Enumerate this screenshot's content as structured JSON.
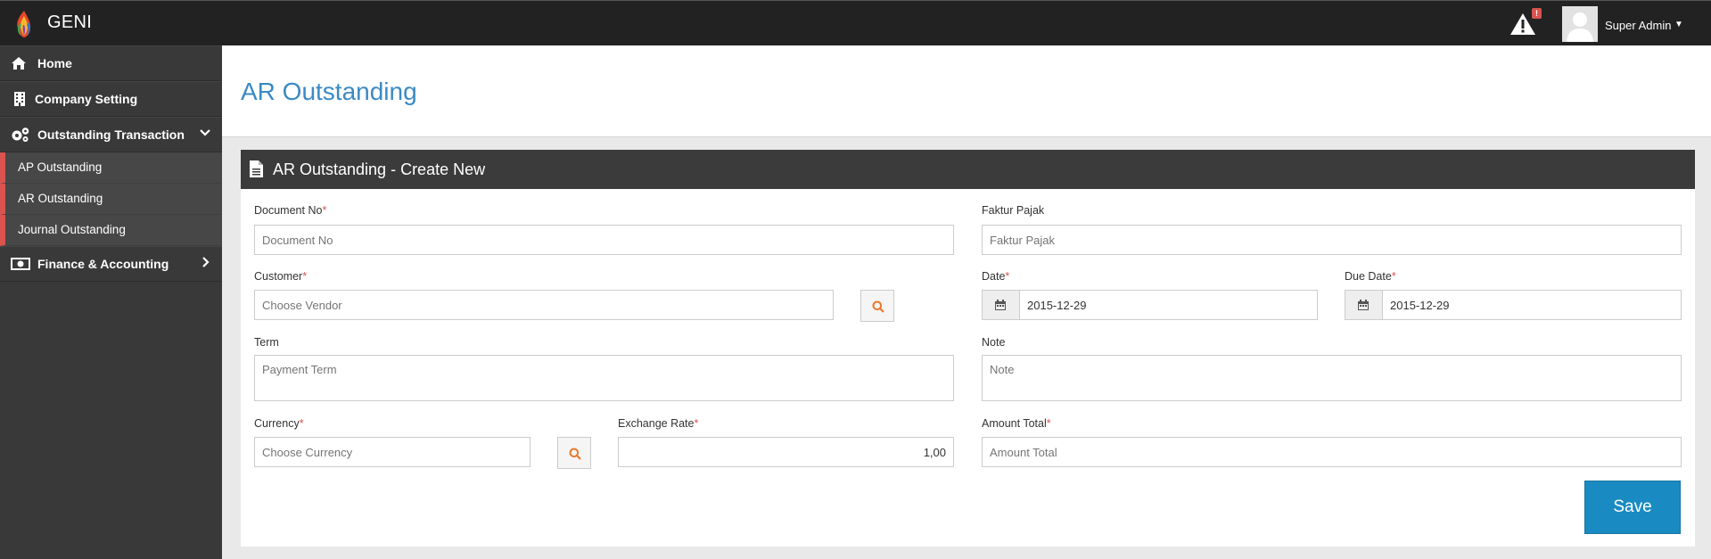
{
  "app": {
    "brand": "GENI"
  },
  "header": {
    "alert_count": "!",
    "user_name": "Super Admin"
  },
  "sidebar": {
    "items": [
      {
        "label": "Home",
        "icon": "home-icon"
      },
      {
        "label": "Company Setting",
        "icon": "building-icon"
      },
      {
        "label": "Outstanding Transaction",
        "icon": "gears-icon",
        "expanded": true,
        "children": [
          "AP Outstanding",
          "AR Outstanding",
          "Journal Outstanding"
        ]
      },
      {
        "label": "Finance & Accounting",
        "icon": "money-icon"
      }
    ]
  },
  "page": {
    "title": "AR Outstanding"
  },
  "form": {
    "panel_title": "AR Outstanding - Create New",
    "document_no": {
      "label": "Document No",
      "placeholder": "Document No",
      "required": "*"
    },
    "faktur_pajak": {
      "label": "Faktur Pajak",
      "placeholder": "Faktur Pajak"
    },
    "customer": {
      "label": "Customer",
      "placeholder": "Choose Vendor",
      "required": "*"
    },
    "date": {
      "label": "Date",
      "value": "2015-12-29",
      "required": "*"
    },
    "due_date": {
      "label": "Due Date",
      "value": "2015-12-29",
      "required": "*"
    },
    "term": {
      "label": "Term",
      "placeholder": "Payment Term"
    },
    "note": {
      "label": "Note",
      "placeholder": "Note"
    },
    "currency": {
      "label": "Currency",
      "placeholder": "Choose Currency",
      "required": "*"
    },
    "exchange_rate": {
      "label": "Exchange Rate",
      "value": "1,00",
      "required": "*"
    },
    "amount_total": {
      "label": "Amount Total",
      "placeholder": "Amount Total",
      "required": "*"
    },
    "save_label": "Save"
  },
  "colors": {
    "accent": "#3a8ac4",
    "save": "#1a8bc2",
    "required": "#d9534f",
    "topbar": "#222222",
    "sidebar": "#393939"
  }
}
